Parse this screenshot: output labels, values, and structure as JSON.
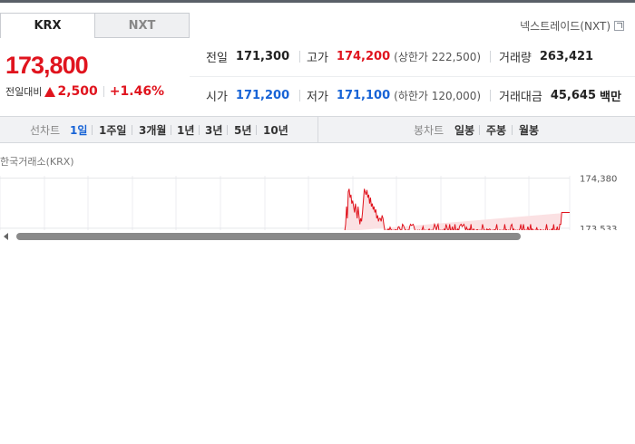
{
  "tabs": [
    {
      "label": "KRX",
      "active": true
    },
    {
      "label": "NXT",
      "active": false
    }
  ],
  "next_trade_link": "넥스트레이드(NXT)",
  "price": {
    "current": "173,800",
    "change_label": "전일대비",
    "change_amount": "2,500",
    "change_percent": "+1.46%",
    "direction": "up"
  },
  "info": {
    "prev_close": {
      "label": "전일",
      "value": "171,300"
    },
    "high": {
      "label": "고가",
      "value": "174,200",
      "sub": "(상한가 222,500)"
    },
    "volume": {
      "label": "거래량",
      "value": "263,421"
    },
    "open": {
      "label": "시가",
      "value": "171,200"
    },
    "low": {
      "label": "저가",
      "value": "171,100",
      "sub": "(하한가 120,000)"
    },
    "trade_value": {
      "label": "거래대금",
      "value": "45,645",
      "unit": "백만"
    }
  },
  "line_chart_bar": {
    "label": "선차트",
    "periods": [
      "1일",
      "1주일",
      "3개월",
      "1년",
      "3년",
      "5년",
      "10년"
    ],
    "active_period": "1일"
  },
  "candle_chart_bar": {
    "label": "봉차트",
    "periods": [
      "일봉",
      "주봉",
      "월봉"
    ]
  },
  "chart_source": "한국거래소(KRX)",
  "chart_data": {
    "type": "line",
    "y_tick_labels": [
      "174,380",
      "173,533"
    ],
    "y_ticks": [
      174380,
      173533
    ],
    "ylim": [
      173470,
      174420
    ],
    "grid": true,
    "x_count": 254,
    "points_x": [
      0,
      1,
      2,
      3,
      4,
      5,
      6,
      7,
      8,
      9,
      10,
      11,
      12,
      13,
      14,
      15,
      16,
      17,
      18,
      19,
      20,
      21,
      22,
      23,
      24,
      25,
      26,
      27,
      28,
      29,
      30,
      31,
      32,
      33,
      34,
      35,
      36,
      37,
      38,
      39,
      40,
      41,
      42,
      43,
      44,
      45,
      46,
      47,
      48,
      49,
      50,
      51,
      52,
      53,
      54,
      55,
      56,
      57,
      58,
      59,
      60,
      61,
      62,
      63,
      64,
      65,
      66,
      67,
      68,
      69,
      70,
      71,
      72,
      73,
      74,
      75,
      76,
      77,
      78,
      79,
      80,
      81,
      82,
      83,
      84,
      85,
      86,
      87,
      88,
      89,
      90,
      91,
      92,
      93,
      94,
      95,
      96,
      97,
      98,
      99,
      100,
      101,
      102,
      103,
      104,
      105,
      106,
      107,
      108,
      109,
      110,
      111,
      112,
      113,
      114,
      115,
      116,
      117,
      118,
      119,
      120,
      121,
      122,
      123,
      124,
      125,
      126,
      127,
      128,
      129,
      130,
      131,
      132,
      133,
      134,
      135,
      136,
      137,
      138,
      139,
      140,
      141,
      142,
      143,
      144,
      145,
      146,
      147,
      148,
      149,
      150,
      151,
      152,
      153,
      154,
      155,
      156,
      157,
      158,
      159,
      160,
      161,
      162,
      163,
      164,
      165,
      166,
      167,
      168,
      169,
      170,
      171,
      172,
      173,
      174,
      175,
      176,
      177,
      178,
      179,
      180,
      181,
      182,
      183,
      184,
      185,
      186,
      187,
      188,
      189,
      190,
      191,
      192,
      193,
      194,
      195,
      196,
      197,
      198,
      199,
      200,
      201,
      202,
      203,
      204,
      205,
      206,
      207,
      208,
      209,
      210,
      211,
      212,
      213,
      214,
      215,
      216,
      217,
      218,
      219,
      220,
      221,
      222,
      223,
      224,
      225,
      226,
      227,
      228,
      229,
      230,
      231,
      232,
      233,
      234,
      235,
      236,
      237,
      238,
      239,
      240,
      241,
      242,
      243,
      244,
      245,
      246,
      247,
      248,
      249,
      250,
      251,
      252,
      253
    ],
    "values": [
      173480,
      173600,
      173900,
      173700,
      174150,
      174200,
      174050,
      174100,
      173950,
      174000,
      173900,
      173800,
      173950,
      173850,
      173700,
      173900,
      173750,
      173600,
      173700,
      173650,
      173800,
      174000,
      174200,
      174150,
      174100,
      174180,
      174050,
      174100,
      173950,
      174050,
      173900,
      173950,
      173850,
      173900,
      173800,
      173850,
      173700,
      173750,
      173650,
      173700,
      173700,
      173650,
      173750,
      173700,
      173600,
      173500,
      173480,
      173500,
      173490,
      173520,
      173500,
      173550,
      173510,
      173500,
      173480,
      173500,
      173490,
      173510,
      173500,
      173480,
      173550,
      173560,
      173520,
      173500,
      173490,
      173600,
      173580,
      173540,
      173500,
      173500,
      173480,
      173500,
      173480,
      173560,
      173600,
      173580,
      173590,
      173600,
      173550,
      173500,
      173480,
      173490,
      173500,
      173480,
      173500,
      173480,
      173480,
      173510,
      173560,
      173500,
      173480,
      173500,
      173480,
      173490,
      173500,
      173520,
      173480,
      173500,
      173480,
      173500,
      173530,
      173600,
      173560,
      173500,
      173560,
      173600,
      173500,
      173480,
      173500,
      173480,
      173500,
      173480,
      173520,
      173500,
      173600,
      173550,
      173480,
      173500,
      173600,
      173500,
      173480,
      173560,
      173500,
      173480,
      173600,
      173500,
      173490,
      173520,
      173480,
      173560,
      173590,
      173600,
      173560,
      173580,
      173600,
      173560,
      173500,
      173550,
      173510,
      173480,
      173520,
      173490,
      173600,
      173480,
      173500,
      173520,
      173500,
      173480,
      173500,
      173510,
      173500,
      173480,
      173500,
      173480,
      173500,
      173600,
      173540,
      173480,
      173500,
      173480,
      173520,
      173500,
      173510,
      173520,
      173500,
      173480,
      173500,
      173480,
      173510,
      173500,
      173520,
      173600,
      173480,
      173480,
      173500,
      173500,
      173480,
      173500,
      173480,
      173500,
      173600,
      173500,
      173510,
      173480,
      173500,
      173490,
      173500,
      173580,
      173600,
      173500,
      173520,
      173480,
      173500,
      173480,
      173500,
      173480,
      173500,
      173520,
      173600,
      173500,
      173500,
      173600,
      173510,
      173500,
      173480,
      173500,
      173560,
      173500,
      173500,
      173600,
      173500,
      173520,
      173480,
      173500,
      173480,
      173500,
      173550,
      173480,
      173500,
      173480,
      173510,
      173500,
      173480,
      173500,
      173500,
      173480,
      173500,
      173600,
      173500,
      173480,
      173500,
      173480,
      173500,
      173520,
      173500,
      173600,
      173480,
      173500,
      173500,
      173560,
      173480,
      173500,
      173600,
      173600,
      173800,
      173800,
      173800,
      173800,
      173800,
      173800,
      173800,
      173800,
      173800,
      173800,
      173800,
      173800,
      173800
    ],
    "line_color": "#e0141e",
    "fill_color": "#fbe1e3"
  },
  "colors": {
    "up": "#e0141e",
    "down": "#1763d6",
    "active_period": "#1763d6"
  }
}
